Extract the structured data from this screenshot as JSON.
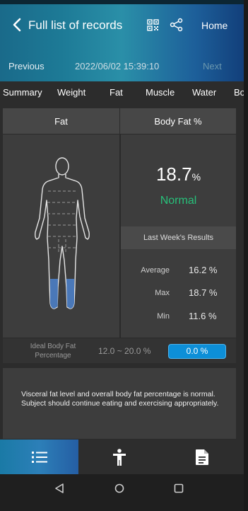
{
  "header": {
    "title": "Full list of records",
    "home_label": "Home",
    "previous_label": "Previous",
    "next_label": "Next",
    "record_datetime": "2022/06/02 15:39:10",
    "icons": [
      "back-chevron-icon",
      "qr-code-icon",
      "share-icon"
    ]
  },
  "tabs": [
    {
      "label": "Summary",
      "active": false
    },
    {
      "label": "Weight",
      "active": false
    },
    {
      "label": "Fat",
      "active": true
    },
    {
      "label": "Muscle",
      "active": false
    },
    {
      "label": "Water",
      "active": false
    },
    {
      "label": "Bo",
      "active": false
    }
  ],
  "card": {
    "left_header": "Fat",
    "right_header": "Body Fat %",
    "value": "18.7",
    "unit": "%",
    "status": "Normal",
    "status_color": "#27c07a",
    "last_week": {
      "title": "Last Week's Results",
      "rows": [
        {
          "label": "Average",
          "value": "16.2 %"
        },
        {
          "label": "Max",
          "value": "18.7 %"
        },
        {
          "label": "Min",
          "value": "11.6 %"
        }
      ]
    },
    "ideal": {
      "label": "Ideal Body Fat Percentage",
      "range": "12.0 ~ 20.0  %",
      "pill_value": "0.0 %",
      "pill_color": "#0d8fd8"
    }
  },
  "note": {
    "text": "Visceral fat level and overall body fat percentage is normal. Subject should continue eating and exercising appropriately."
  },
  "bottom_nav": {
    "items": [
      "list-icon",
      "person-icon",
      "document-icon"
    ],
    "active": "list-icon"
  },
  "system_nav": [
    "back-triangle-icon",
    "home-circle-icon",
    "recents-square-icon"
  ],
  "colors": {
    "accent": "#0d8fd8",
    "header_gradient_start": "#1a6a8a",
    "header_gradient_end": "#123f7a",
    "figure_legs": "#4a78b8"
  }
}
